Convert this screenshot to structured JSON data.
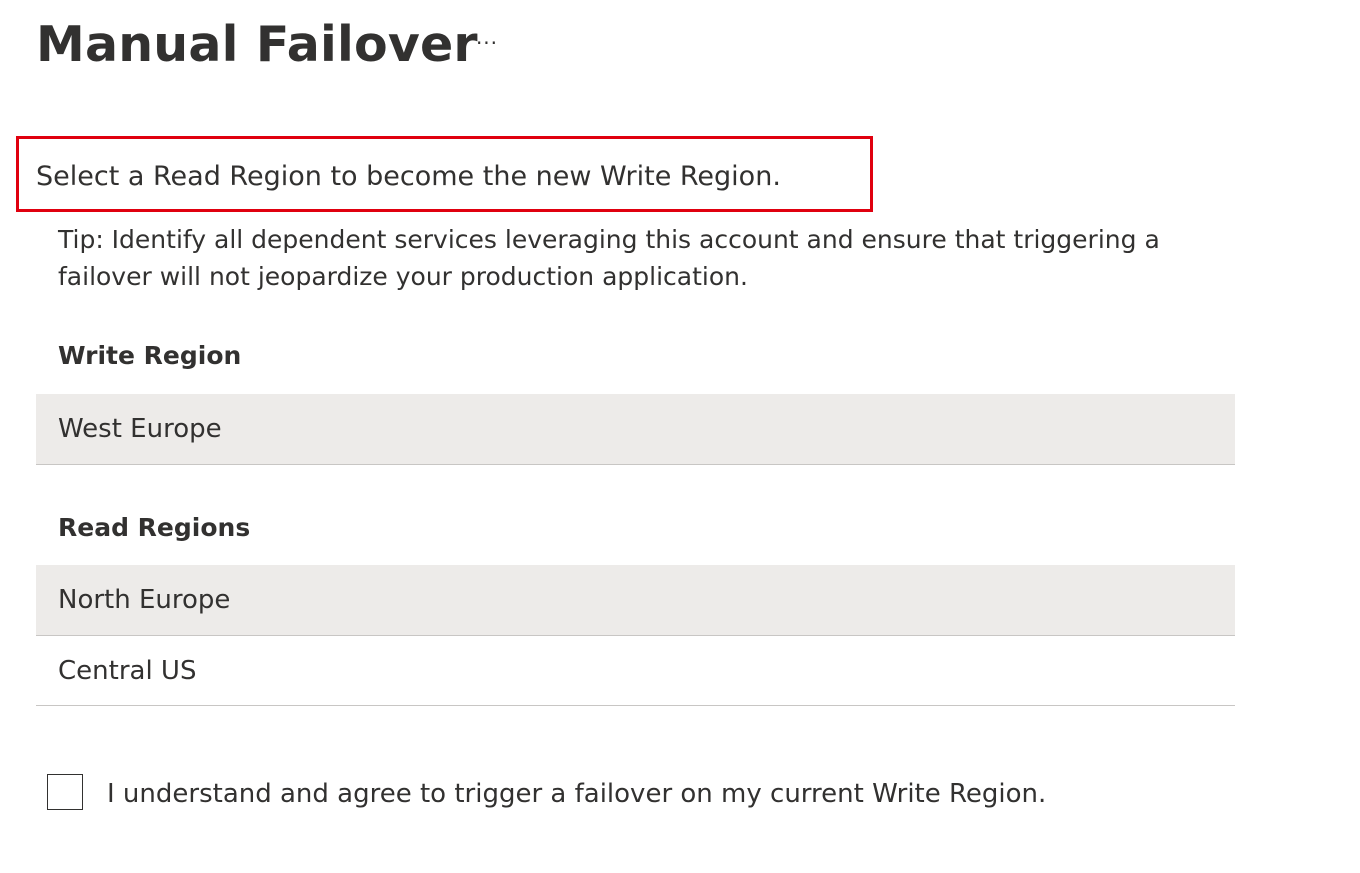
{
  "header": {
    "title": "Manual Failover",
    "more_label": "···"
  },
  "instruction": "Select a Read Region to become the new Write Region.",
  "tip": "Tip: Identify all dependent services leveraging this account and ensure that triggering a failover will not jeopardize your production application.",
  "write_region": {
    "label": "Write Region",
    "value": "West Europe"
  },
  "read_regions": {
    "label": "Read Regions",
    "items": [
      {
        "name": "North Europe",
        "selected": true
      },
      {
        "name": "Central US",
        "selected": false
      }
    ]
  },
  "agreement": {
    "label": "I understand and agree to trigger a failover on my current Write Region.",
    "checked": false
  },
  "colors": {
    "highlight": "#e0000f",
    "row_shade": "#edebe9",
    "text": "#323130",
    "divider": "#c8c6c4"
  }
}
